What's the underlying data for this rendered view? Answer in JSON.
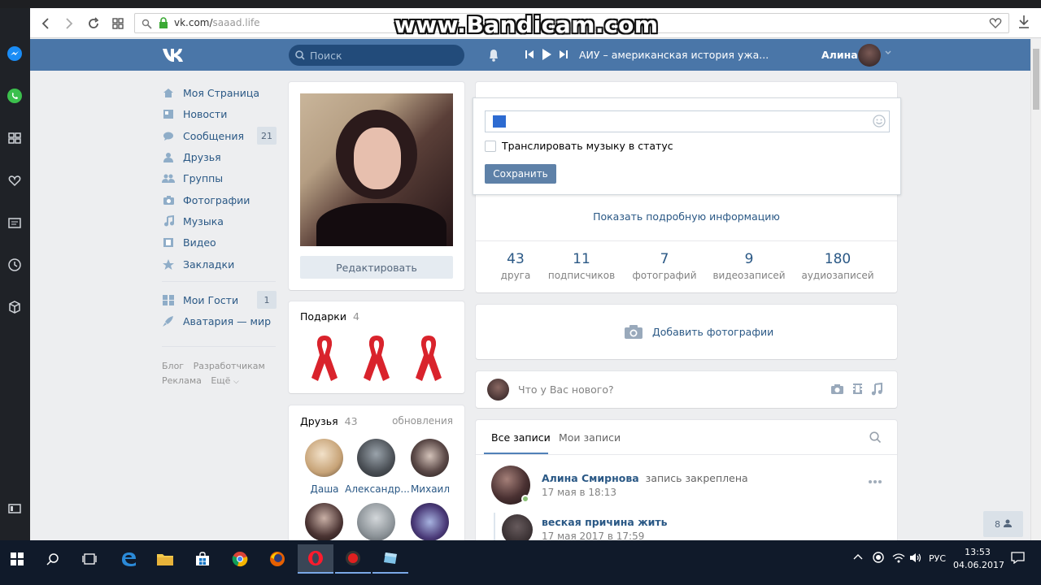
{
  "watermark": "www.Bandicam.com",
  "browser": {
    "url_host": "vk.com/",
    "url_path": "saaad.life"
  },
  "header": {
    "search_placeholder": "Поиск",
    "track": "АИУ – американская история ужа...",
    "user_name": "Алина"
  },
  "menu": {
    "items": [
      {
        "label": "Моя Страница"
      },
      {
        "label": "Новости"
      },
      {
        "label": "Сообщения",
        "badge": "21"
      },
      {
        "label": "Друзья"
      },
      {
        "label": "Группы"
      },
      {
        "label": "Фотографии"
      },
      {
        "label": "Музыка"
      },
      {
        "label": "Видео"
      },
      {
        "label": "Закладки"
      }
    ],
    "apps": [
      {
        "label": "Мои Гости",
        "badge": "1"
      },
      {
        "label": "Аватария — мир"
      }
    ],
    "footer": {
      "blog": "Блог",
      "developers": "Разработчикам",
      "ads": "Реклама",
      "more": "Ещё"
    }
  },
  "profile": {
    "edit_button": "Редактировать"
  },
  "gifts": {
    "title": "Подарки",
    "count": "4"
  },
  "friends": {
    "title": "Друзья",
    "count": "43",
    "updates": "обновления",
    "row1": [
      "Даша",
      "Александр...",
      "Михаил"
    ]
  },
  "status_editor": {
    "checkbox_label": "Транслировать музыку в статус",
    "save_button": "Сохранить"
  },
  "info": {
    "show_more": "Показать подробную информацию"
  },
  "counters": [
    {
      "value": "43",
      "label": "друга"
    },
    {
      "value": "11",
      "label": "подписчиков"
    },
    {
      "value": "7",
      "label": "фотографий"
    },
    {
      "value": "9",
      "label": "видеозаписей"
    },
    {
      "value": "180",
      "label": "аудиозаписей"
    }
  ],
  "add_photos": "Добавить фотографии",
  "composer": {
    "placeholder": "Что у Вас нового?"
  },
  "wall": {
    "tab_all": "Все записи",
    "tab_mine": "Мои записи",
    "post": {
      "author": "Алина Смирнова",
      "pinned": "запись закреплена",
      "date": "17 мая в 18:13",
      "repost_title": "веская причина жить",
      "repost_date": "17 мая 2017 в 17:59"
    }
  },
  "online_counter": "8",
  "tray": {
    "lang": "РУС",
    "time": "13:53",
    "date": "04.06.2017"
  }
}
